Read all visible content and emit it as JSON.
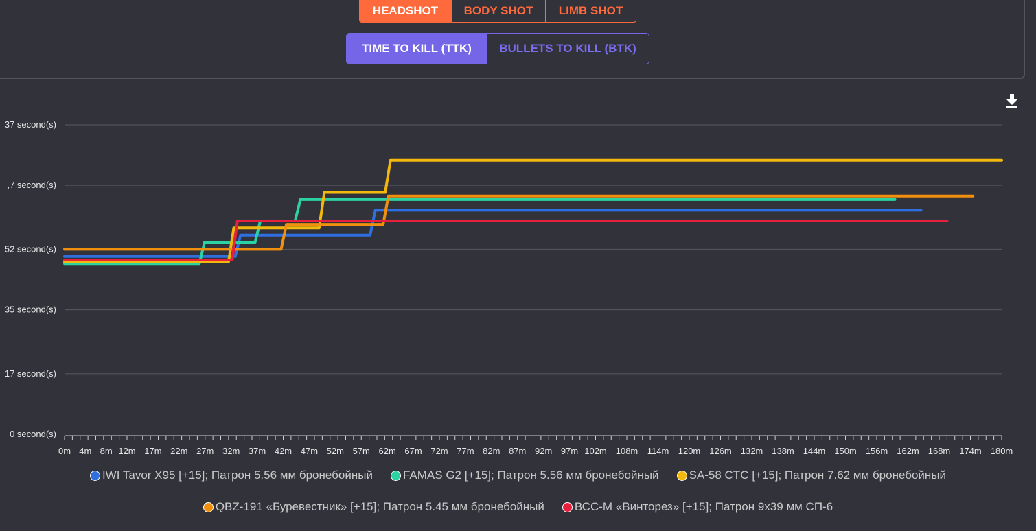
{
  "hit_zone_tabs": [
    {
      "label": "HEADSHOT",
      "active": true
    },
    {
      "label": "BODY SHOT",
      "active": false
    },
    {
      "label": "LIMB SHOT",
      "active": false
    }
  ],
  "metric_tabs": [
    {
      "label": "TIME TO KILL (TTK)",
      "active": true
    },
    {
      "label": "BULLETS TO KILL (BTK)",
      "active": false
    }
  ],
  "colors": {
    "accent_orange": "#ff6a3d",
    "accent_purple": "#7466e6",
    "background": "#32323b"
  },
  "icons": {
    "download": "download-icon"
  },
  "chart_data": {
    "type": "line",
    "title": "",
    "xlabel": "",
    "ylabel": "",
    "y_tick_labels": [
      "0 second(s)",
      "17 second(s)",
      "35 second(s)",
      "52 second(s)",
      ",7 second(s)",
      "37 second(s)"
    ],
    "y_tick_values": [
      0,
      0.17,
      0.35,
      0.52,
      0.7,
      0.87
    ],
    "ylim": [
      0,
      0.87
    ],
    "x_tick_labels": [
      "0m",
      "4m",
      "8m",
      "12m",
      "17m",
      "22m",
      "27m",
      "32m",
      "37m",
      "42m",
      "47m",
      "52m",
      "57m",
      "62m",
      "67m",
      "72m",
      "77m",
      "82m",
      "87m",
      "92m",
      "97m",
      "102m",
      "108m",
      "114m",
      "120m",
      "126m",
      "132m",
      "138m",
      "144m",
      "150m",
      "156m",
      "162m",
      "168m",
      "174m",
      "180m"
    ],
    "x_tick_values": [
      0,
      4,
      8,
      12,
      17,
      22,
      27,
      32,
      37,
      42,
      47,
      52,
      57,
      62,
      67,
      72,
      77,
      82,
      87,
      92,
      97,
      102,
      108,
      114,
      120,
      126,
      132,
      138,
      144,
      150,
      156,
      162,
      168,
      174,
      180
    ],
    "xlim": [
      0,
      180
    ],
    "grid": true,
    "legend_position": "bottom",
    "series": [
      {
        "name": "IWI Tavor X95 [+15]; Патрон 5.56 мм бронебойный",
        "color": "#2f6fe0",
        "points": [
          [
            0,
            0.5
          ],
          [
            32.8,
            0.5
          ],
          [
            33.8,
            0.56
          ],
          [
            58.7,
            0.56
          ],
          [
            59.7,
            0.63
          ],
          [
            164.5,
            0.63
          ]
        ]
      },
      {
        "name": "FAMAS G2 [+15]; Патрон 5.56 мм бронебойный",
        "color": "#2bd3a3",
        "points": [
          [
            0,
            0.48
          ],
          [
            25.9,
            0.48
          ],
          [
            26.9,
            0.54
          ],
          [
            36.6,
            0.54
          ],
          [
            37.6,
            0.6
          ],
          [
            44.3,
            0.6
          ],
          [
            45.3,
            0.66
          ],
          [
            159.5,
            0.66
          ]
        ]
      },
      {
        "name": "SA-58 CTC [+15]; Патрон 7.62 мм бронебойный",
        "color": "#f2b90c",
        "points": [
          [
            0,
            0.485
          ],
          [
            31.5,
            0.485
          ],
          [
            32.5,
            0.58
          ],
          [
            48.9,
            0.58
          ],
          [
            49.9,
            0.68
          ],
          [
            61.6,
            0.68
          ],
          [
            62.6,
            0.77
          ],
          [
            180,
            0.77
          ]
        ]
      },
      {
        "name": "QBZ-191 «Буревестник» [+15]; Патрон 5.45 мм бронебойный",
        "color": "#f0900c",
        "points": [
          [
            0,
            0.52
          ],
          [
            41.6,
            0.52
          ],
          [
            42.6,
            0.59
          ],
          [
            61.2,
            0.59
          ],
          [
            62.2,
            0.67
          ],
          [
            174.5,
            0.67
          ]
        ]
      },
      {
        "name": "ВСС-М «Винторез» [+15]; Патрон 9x39 мм СП-6",
        "color": "#e8203e",
        "points": [
          [
            0,
            0.49
          ],
          [
            32.2,
            0.49
          ],
          [
            33.2,
            0.6
          ],
          [
            169.5,
            0.6
          ]
        ]
      }
    ]
  }
}
